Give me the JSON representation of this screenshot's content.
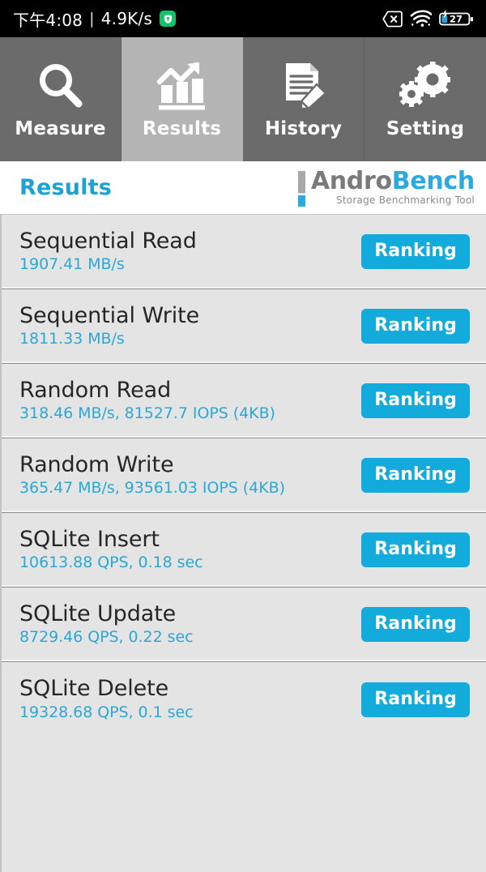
{
  "status_bar": {
    "time": "下午4:08",
    "separator": "|",
    "network_speed": "4.9K/s",
    "badge_icon": "shield-location-icon",
    "icons": {
      "sim_off": "sim-card-off-icon",
      "wifi": "wifi-icon",
      "battery": "battery-charging-icon"
    },
    "battery_level": "27",
    "background_color": "#000000",
    "text_color": "#ffffff"
  },
  "tabs": [
    {
      "label": "Measure",
      "icon": "magnifier-icon",
      "active": false
    },
    {
      "label": "Results",
      "icon": "bar-chart-arrow-icon",
      "active": true
    },
    {
      "label": "History",
      "icon": "document-pencil-icon",
      "active": false
    },
    {
      "label": "Setting",
      "icon": "gears-icon",
      "active": false
    }
  ],
  "header": {
    "title": "Results",
    "logo": {
      "word_part_1": "Andro",
      "word_part_2": "Bench",
      "subtitle": "Storage Benchmarking Tool"
    }
  },
  "results": [
    {
      "title": "Sequential Read",
      "value": "1907.41 MB/s",
      "button": "Ranking"
    },
    {
      "title": "Sequential Write",
      "value": "1811.33 MB/s",
      "button": "Ranking"
    },
    {
      "title": "Random Read",
      "value": "318.46 MB/s, 81527.7 IOPS (4KB)",
      "button": "Ranking"
    },
    {
      "title": "Random Write",
      "value": "365.47 MB/s, 93561.03 IOPS (4KB)",
      "button": "Ranking"
    },
    {
      "title": "SQLite Insert",
      "value": "10613.88 QPS, 0.18 sec",
      "button": "Ranking"
    },
    {
      "title": "SQLite Update",
      "value": "8729.46 QPS, 0.22 sec",
      "button": "Ranking"
    },
    {
      "title": "SQLite Delete",
      "value": "19328.68 QPS, 0.1 sec",
      "button": "Ranking"
    }
  ],
  "colors": {
    "accent_blue": "#12abdb",
    "value_blue": "#2ba8d5",
    "title_blue": "#1ba3d6",
    "tab_inactive": "#6b6b6b",
    "tab_active": "#b4b4b4",
    "row_background": "#e4e4e4",
    "logo_gray": "#7a7a7a"
  }
}
